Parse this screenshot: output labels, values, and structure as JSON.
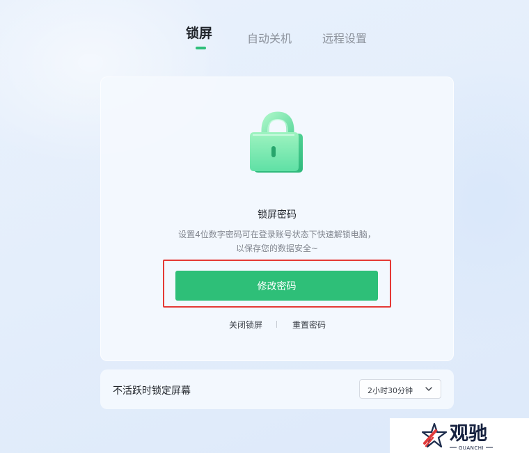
{
  "tabs": [
    {
      "label": "锁屏",
      "active": true
    },
    {
      "label": "自动关机",
      "active": false
    },
    {
      "label": "远程设置",
      "active": false
    }
  ],
  "lock_card": {
    "icon": "padlock-icon",
    "title": "锁屏密码",
    "description": "设置4位数字密码可在登录账号状态下快速解锁电脑，以保存您的数据安全~",
    "primary_button": "修改密码",
    "links": [
      "关闭锁屏",
      "重置密码"
    ]
  },
  "inactivity_setting": {
    "label": "不活跃时锁定屏幕",
    "selected": "2小时30分钟"
  },
  "watermark": {
    "brand": "观驰",
    "sub": "GUANCHI"
  },
  "colors": {
    "accent_green": "#2ebf78",
    "highlight_red": "#e53935"
  }
}
